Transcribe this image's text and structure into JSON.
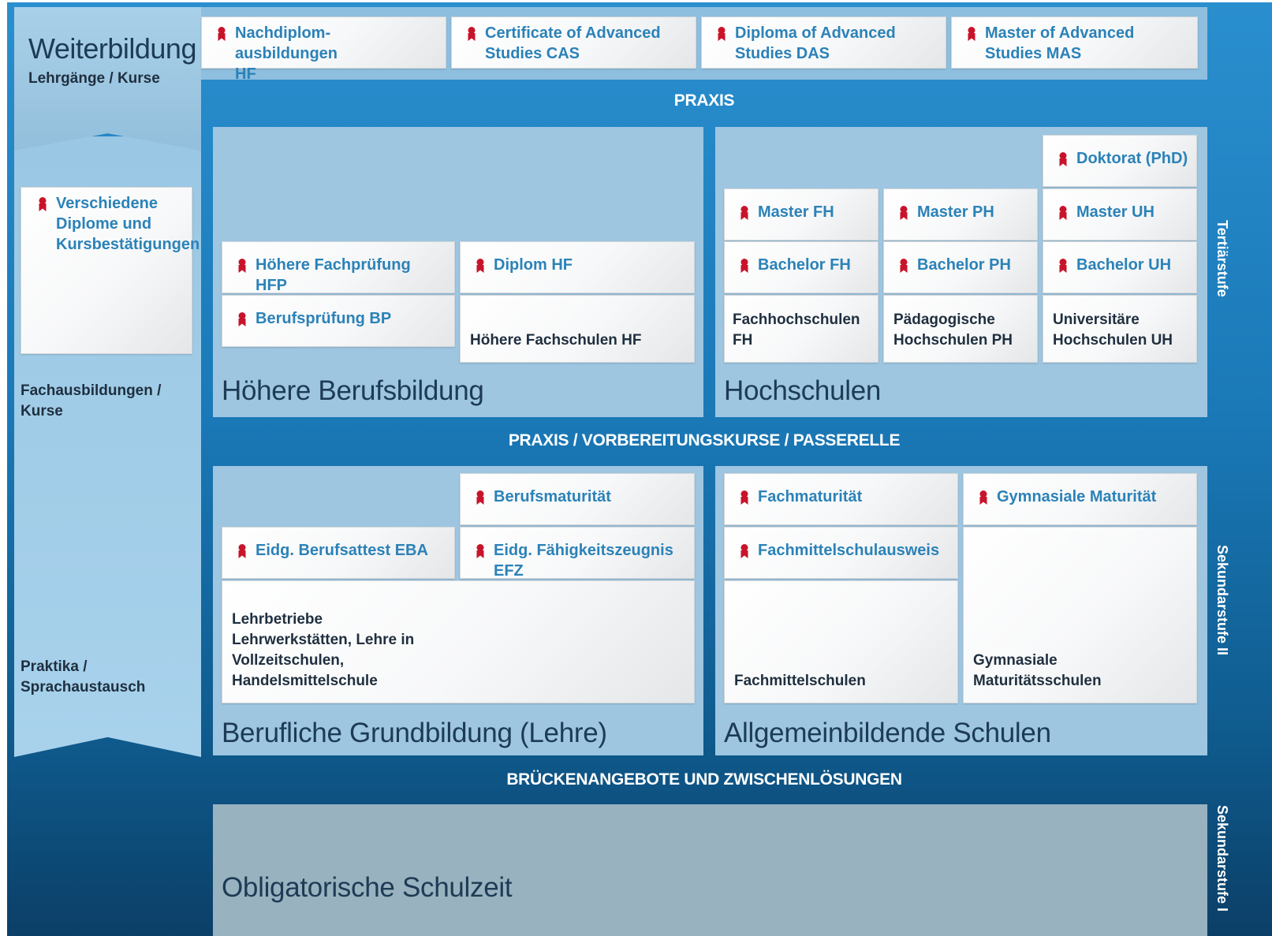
{
  "left": {
    "title": "Weiterbildung",
    "subtitle": "Lehrgänge / Kurse",
    "diploma_card": "Verschiedene Diplome und Kursbestätigungen",
    "fachausbildungen": "Fachausbildungen / Kurse",
    "praktika": "Praktika / Sprachaustausch"
  },
  "weiterbildung_certs": [
    "Nachdiplom-ausbildungen HF",
    "Certificate of Advanced Studies CAS",
    "Diploma of Advanced Studies DAS",
    "Master of Advanced Studies MAS"
  ],
  "bands": {
    "praxis": "PRAXIS",
    "praxis_vorbereitung": "PRAXIS / VORBEREITUNGSKURSE / PASSERELLE",
    "brueckenangebote": "BRÜCKENANGEBOTE UND ZWISCHENLÖSUNGEN"
  },
  "levels": {
    "tertiaer": "Tertiärstufe",
    "sek2": "Sekundarstufe II",
    "sek1": "Sekundarstufe I"
  },
  "hoehere_berufsbildung": {
    "title": "Höhere Berufsbildung",
    "hfp": "Höhere Fachprüfung HFP",
    "bp": "Berufsprüfung BP",
    "diplom_hf": "Diplom HF",
    "hf_inst": "Höhere Fachschulen HF"
  },
  "hochschulen": {
    "title": "Hochschulen",
    "doktorat": "Doktorat (PhD)",
    "master_fh": "Master FH",
    "master_ph": "Master PH",
    "master_uh": "Master UH",
    "bachelor_fh": "Bachelor FH",
    "bachelor_ph": "Bachelor PH",
    "bachelor_uh": "Bachelor UH",
    "fh_inst": "Fachhochschulen FH",
    "ph_inst": "Pädagogische Hochschulen PH",
    "uh_inst": "Universitäre Hochschulen UH"
  },
  "grundbildung": {
    "title": "Berufliche Grundbildung (Lehre)",
    "berufsmaturitaet": "Berufsmaturität",
    "eba": "Eidg. Berufsattest EBA",
    "efz": "Eidg. Fähigkeitszeugnis EFZ",
    "inst": "Lehrbetriebe Lehrwerkstätten, Lehre in Vollzeitschulen, Handelsmittelschule"
  },
  "allgemeinbildend": {
    "title": "Allgemeinbildende Schulen",
    "fachmaturitaet": "Fachmaturität",
    "gym_maturitaet": "Gymnasiale Maturität",
    "fms_ausweis": "Fachmittelschulausweis",
    "fms_inst": "Fachmittelschulen",
    "gym_inst": "Gymnasiale Maturitätsschulen"
  },
  "obligatorisch": {
    "title": "Obligatorische Schulzeit"
  },
  "colors": {
    "cert_text": "#2b82b8",
    "award_icon": "#c8142a",
    "panel": "#9ec6e1",
    "band_bg": "#1a78b6"
  }
}
